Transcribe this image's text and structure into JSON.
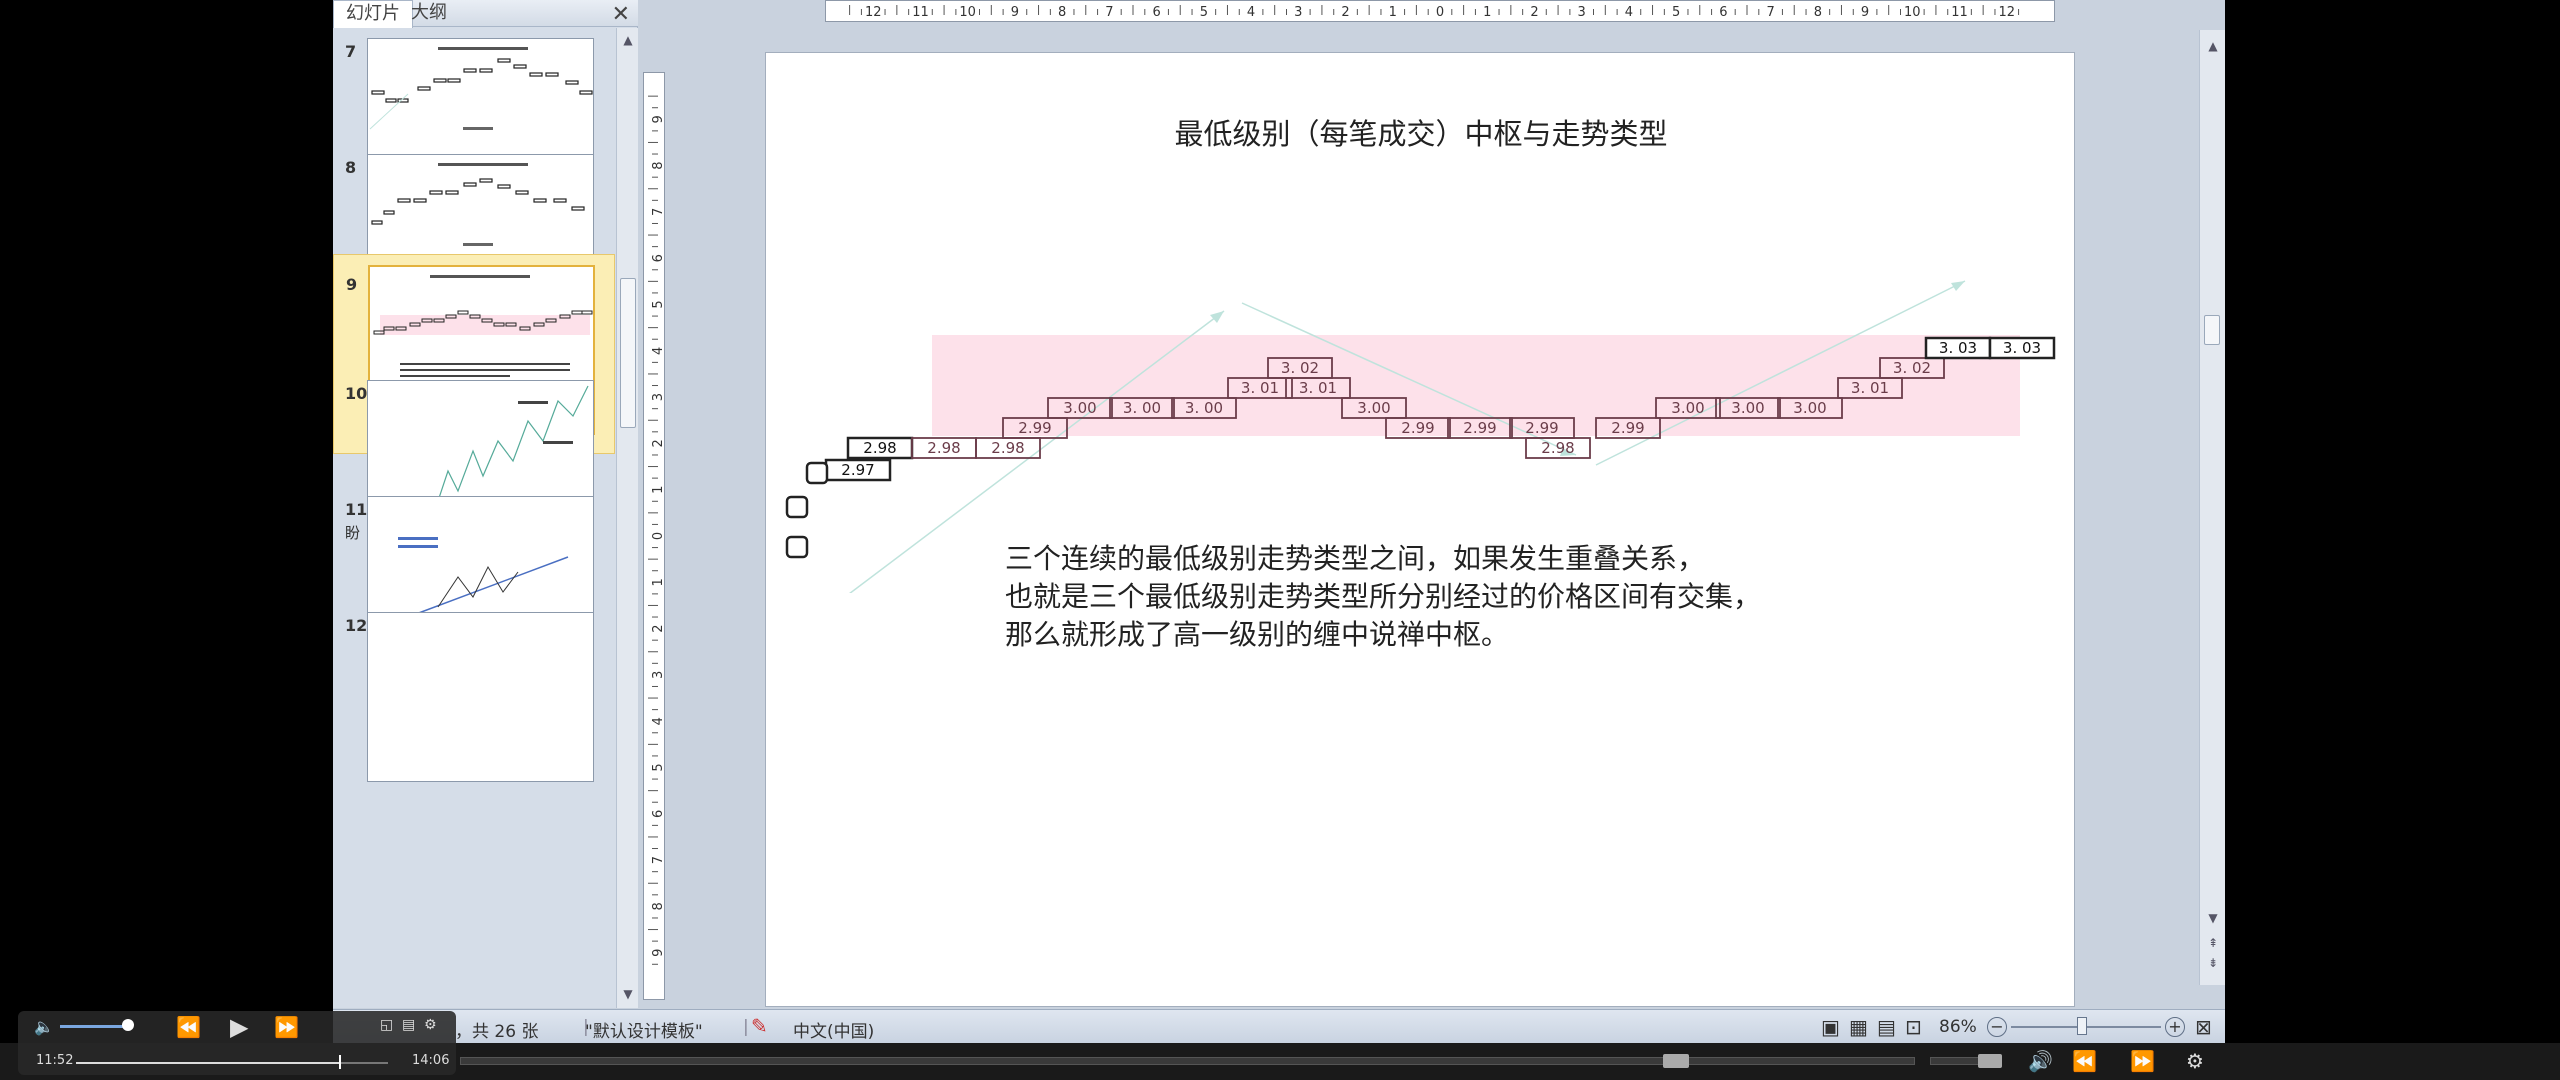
{
  "pane": {
    "tabs": [
      "幻灯片",
      "大纲"
    ],
    "close": "✕",
    "slides": [
      {
        "num": "7",
        "sub": ""
      },
      {
        "num": "8",
        "sub": ""
      },
      {
        "num": "9",
        "sub": ""
      },
      {
        "num": "10",
        "sub": ""
      },
      {
        "num": "11",
        "sub": "盼"
      },
      {
        "num": "12",
        "sub": ""
      }
    ]
  },
  "ruler": {
    "h_ticks": [
      "12",
      "11",
      "10",
      "9",
      "8",
      "7",
      "6",
      "5",
      "4",
      "3",
      "2",
      "1",
      "0",
      "1",
      "2",
      "3",
      "4",
      "5",
      "6",
      "7",
      "8",
      "9",
      "10",
      "11",
      "12"
    ],
    "v_ticks": [
      "9",
      "8",
      "7",
      "6",
      "5",
      "4",
      "3",
      "2",
      "1",
      "0",
      "1",
      "2",
      "3",
      "4",
      "5",
      "6",
      "7",
      "8",
      "9"
    ]
  },
  "slide": {
    "title": "最低级别（每笔成交）中枢与走势类型",
    "body": [
      "三个连续的最低级别走势类型之间，如果发生重叠关系，",
      "也就是三个最低级别走势类型所分别经过的价格区间有交集，",
      "那么就形成了高一级别的缠中说禅中枢。"
    ],
    "boxes": [
      {
        "label": "2.97"
      },
      {
        "label": "2.98"
      },
      {
        "label": "2.98"
      },
      {
        "label": "2.98"
      },
      {
        "label": "2.99"
      },
      {
        "label": "3.00"
      },
      {
        "label": "3. 00"
      },
      {
        "label": "3. 00"
      },
      {
        "label": "3. 01"
      },
      {
        "label": "3. 02"
      },
      {
        "label": "3. 01"
      },
      {
        "label": "3.00"
      },
      {
        "label": "2.99"
      },
      {
        "label": "2.99"
      },
      {
        "label": "2.99"
      },
      {
        "label": "2.98"
      },
      {
        "label": "2.99"
      },
      {
        "label": "3.00"
      },
      {
        "label": "3.00"
      },
      {
        "label": "3.00"
      },
      {
        "label": "3. 01"
      },
      {
        "label": "3. 02"
      },
      {
        "label": "3. 03"
      },
      {
        "label": "3. 03"
      }
    ],
    "colors": {
      "zone": "#fde1ea",
      "arrow": "#bfe3dc",
      "box_border": "#222",
      "pink_box_border": "#6b3d4a"
    }
  },
  "status": {
    "slide_count": "，共 26 张",
    "theme": "\"默认设计模板\"",
    "language": "中文(中国)",
    "zoom": "86%"
  },
  "player": {
    "current": "11:52",
    "total": "14:06",
    "progress": 0.842
  }
}
